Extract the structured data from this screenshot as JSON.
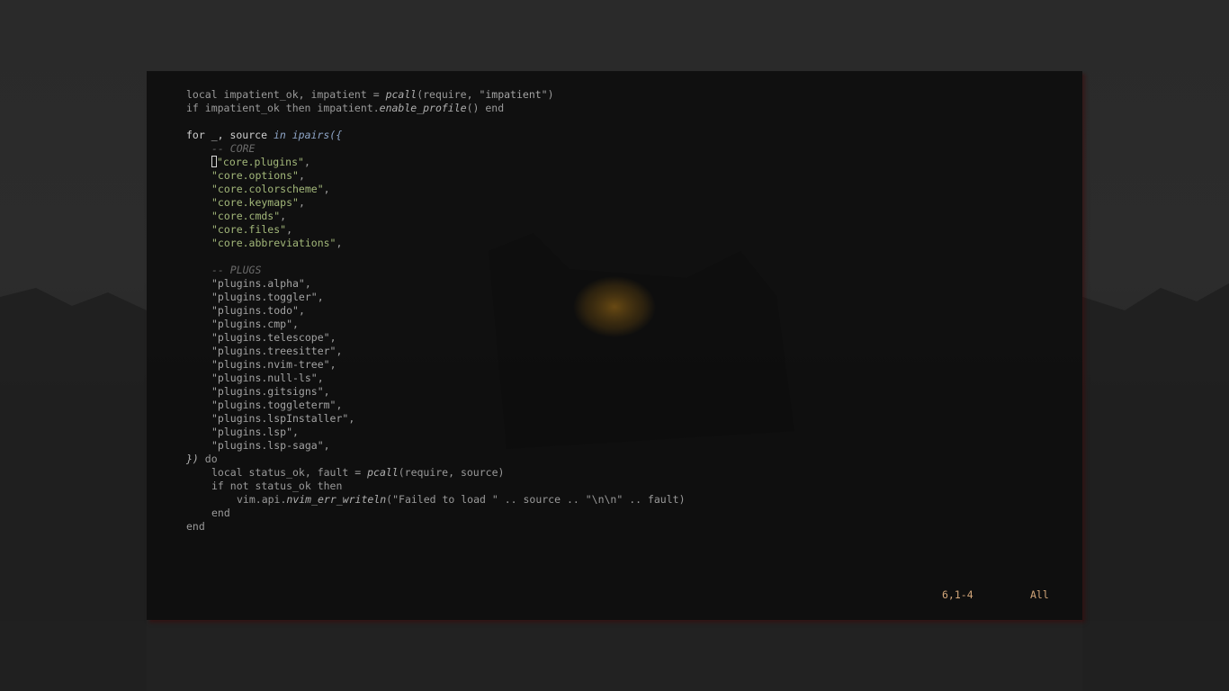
{
  "editor": {
    "lines": [
      {
        "indent": 0,
        "tokens": [
          {
            "text": "local impatient_ok, impatient = ",
            "style": "plain"
          },
          {
            "text": "pcall",
            "style": "fn-italic"
          },
          {
            "text": "(require, ",
            "style": "plain"
          },
          {
            "text": "\"impatient\"",
            "style": "string-gray"
          },
          {
            "text": ")",
            "style": "plain"
          }
        ]
      },
      {
        "indent": 0,
        "tokens": [
          {
            "text": "if impatient_ok then impatient.",
            "style": "plain"
          },
          {
            "text": "enable_profile",
            "style": "fn-italic"
          },
          {
            "text": "() end",
            "style": "plain"
          }
        ]
      },
      {
        "indent": 0,
        "tokens": []
      },
      {
        "indent": 0,
        "tokens": [
          {
            "text": "for _, source ",
            "style": "kw-bright"
          },
          {
            "text": "in ",
            "style": "fn-blue"
          },
          {
            "text": "ipairs",
            "style": "fn-blue"
          },
          {
            "text": "({",
            "style": "fn-blue"
          }
        ]
      },
      {
        "indent": 1,
        "tokens": [
          {
            "text": "-- CORE",
            "style": "comment"
          }
        ]
      },
      {
        "indent": 1,
        "cursor": true,
        "tokens": [
          {
            "text": "\"core.plugins\"",
            "style": "string-green"
          },
          {
            "text": ",",
            "style": "punct"
          }
        ]
      },
      {
        "indent": 1,
        "tokens": [
          {
            "text": "\"core.options\"",
            "style": "string-green"
          },
          {
            "text": ",",
            "style": "punct"
          }
        ]
      },
      {
        "indent": 1,
        "tokens": [
          {
            "text": "\"core.colorscheme\"",
            "style": "string-green"
          },
          {
            "text": ",",
            "style": "punct"
          }
        ]
      },
      {
        "indent": 1,
        "tokens": [
          {
            "text": "\"core.keymaps\"",
            "style": "string-green"
          },
          {
            "text": ",",
            "style": "punct"
          }
        ]
      },
      {
        "indent": 1,
        "tokens": [
          {
            "text": "\"core.cmds\"",
            "style": "string-green"
          },
          {
            "text": ",",
            "style": "punct"
          }
        ]
      },
      {
        "indent": 1,
        "tokens": [
          {
            "text": "\"core.files\"",
            "style": "string-green"
          },
          {
            "text": ",",
            "style": "punct"
          }
        ]
      },
      {
        "indent": 1,
        "tokens": [
          {
            "text": "\"core.abbreviations\"",
            "style": "string-green"
          },
          {
            "text": ",",
            "style": "punct"
          }
        ]
      },
      {
        "indent": 0,
        "tokens": []
      },
      {
        "indent": 1,
        "tokens": [
          {
            "text": "-- PLUGS",
            "style": "comment"
          }
        ]
      },
      {
        "indent": 1,
        "tokens": [
          {
            "text": "\"plugins.alpha\"",
            "style": "string-gray"
          },
          {
            "text": ",",
            "style": "punct"
          }
        ]
      },
      {
        "indent": 1,
        "tokens": [
          {
            "text": "\"plugins.toggler\"",
            "style": "string-gray"
          },
          {
            "text": ",",
            "style": "punct"
          }
        ]
      },
      {
        "indent": 1,
        "tokens": [
          {
            "text": "\"plugins.todo\"",
            "style": "string-gray"
          },
          {
            "text": ",",
            "style": "punct"
          }
        ]
      },
      {
        "indent": 1,
        "tokens": [
          {
            "text": "\"plugins.cmp\"",
            "style": "string-gray"
          },
          {
            "text": ",",
            "style": "punct"
          }
        ]
      },
      {
        "indent": 1,
        "tokens": [
          {
            "text": "\"plugins.telescope\"",
            "style": "string-gray"
          },
          {
            "text": ",",
            "style": "punct"
          }
        ]
      },
      {
        "indent": 1,
        "tokens": [
          {
            "text": "\"plugins.treesitter\"",
            "style": "string-gray"
          },
          {
            "text": ",",
            "style": "punct"
          }
        ]
      },
      {
        "indent": 1,
        "tokens": [
          {
            "text": "\"plugins.nvim-tree\"",
            "style": "string-gray"
          },
          {
            "text": ",",
            "style": "punct"
          }
        ]
      },
      {
        "indent": 1,
        "tokens": [
          {
            "text": "\"plugins.null-ls\"",
            "style": "string-gray"
          },
          {
            "text": ",",
            "style": "punct"
          }
        ]
      },
      {
        "indent": 1,
        "tokens": [
          {
            "text": "\"plugins.gitsigns\"",
            "style": "string-gray"
          },
          {
            "text": ",",
            "style": "punct"
          }
        ]
      },
      {
        "indent": 1,
        "tokens": [
          {
            "text": "\"plugins.toggleterm\"",
            "style": "string-gray"
          },
          {
            "text": ",",
            "style": "punct"
          }
        ]
      },
      {
        "indent": 1,
        "tokens": [
          {
            "text": "\"plugins.lspInstaller\"",
            "style": "string-gray"
          },
          {
            "text": ",",
            "style": "punct"
          }
        ]
      },
      {
        "indent": 1,
        "tokens": [
          {
            "text": "\"plugins.lsp\"",
            "style": "string-gray"
          },
          {
            "text": ",",
            "style": "punct"
          }
        ]
      },
      {
        "indent": 1,
        "tokens": [
          {
            "text": "\"plugins.lsp-saga\"",
            "style": "string-gray"
          },
          {
            "text": ",",
            "style": "punct"
          }
        ]
      },
      {
        "indent": 0,
        "tokens": [
          {
            "text": "})",
            "style": "fn-italic"
          },
          {
            "text": " do",
            "style": "plain"
          }
        ]
      },
      {
        "indent": 1,
        "tokens": [
          {
            "text": "local status_ok, fault = ",
            "style": "plain"
          },
          {
            "text": "pcall",
            "style": "fn-italic"
          },
          {
            "text": "(require, source)",
            "style": "plain"
          }
        ]
      },
      {
        "indent": 1,
        "tokens": [
          {
            "text": "if not status_ok then",
            "style": "plain"
          }
        ]
      },
      {
        "indent": 2,
        "tokens": [
          {
            "text": "vim.api.",
            "style": "plain"
          },
          {
            "text": "nvim_err_writeln",
            "style": "fn-italic"
          },
          {
            "text": "(\"Failed to load \" .. source .. \"\\n\\n\" .. fault)",
            "style": "plain"
          }
        ]
      },
      {
        "indent": 1,
        "tokens": [
          {
            "text": "end",
            "style": "plain"
          }
        ]
      },
      {
        "indent": 0,
        "tokens": [
          {
            "text": "end",
            "style": "plain"
          }
        ]
      }
    ]
  },
  "statusline": {
    "position": "6,1-4",
    "scroll": "All"
  },
  "colors": {
    "string_green": "#a3b87a",
    "comment": "#6b6b6b",
    "keyword_blue": "#8fa6c8",
    "ruler": "#d2a679",
    "wallpaper_glow": "#c98a1a"
  }
}
